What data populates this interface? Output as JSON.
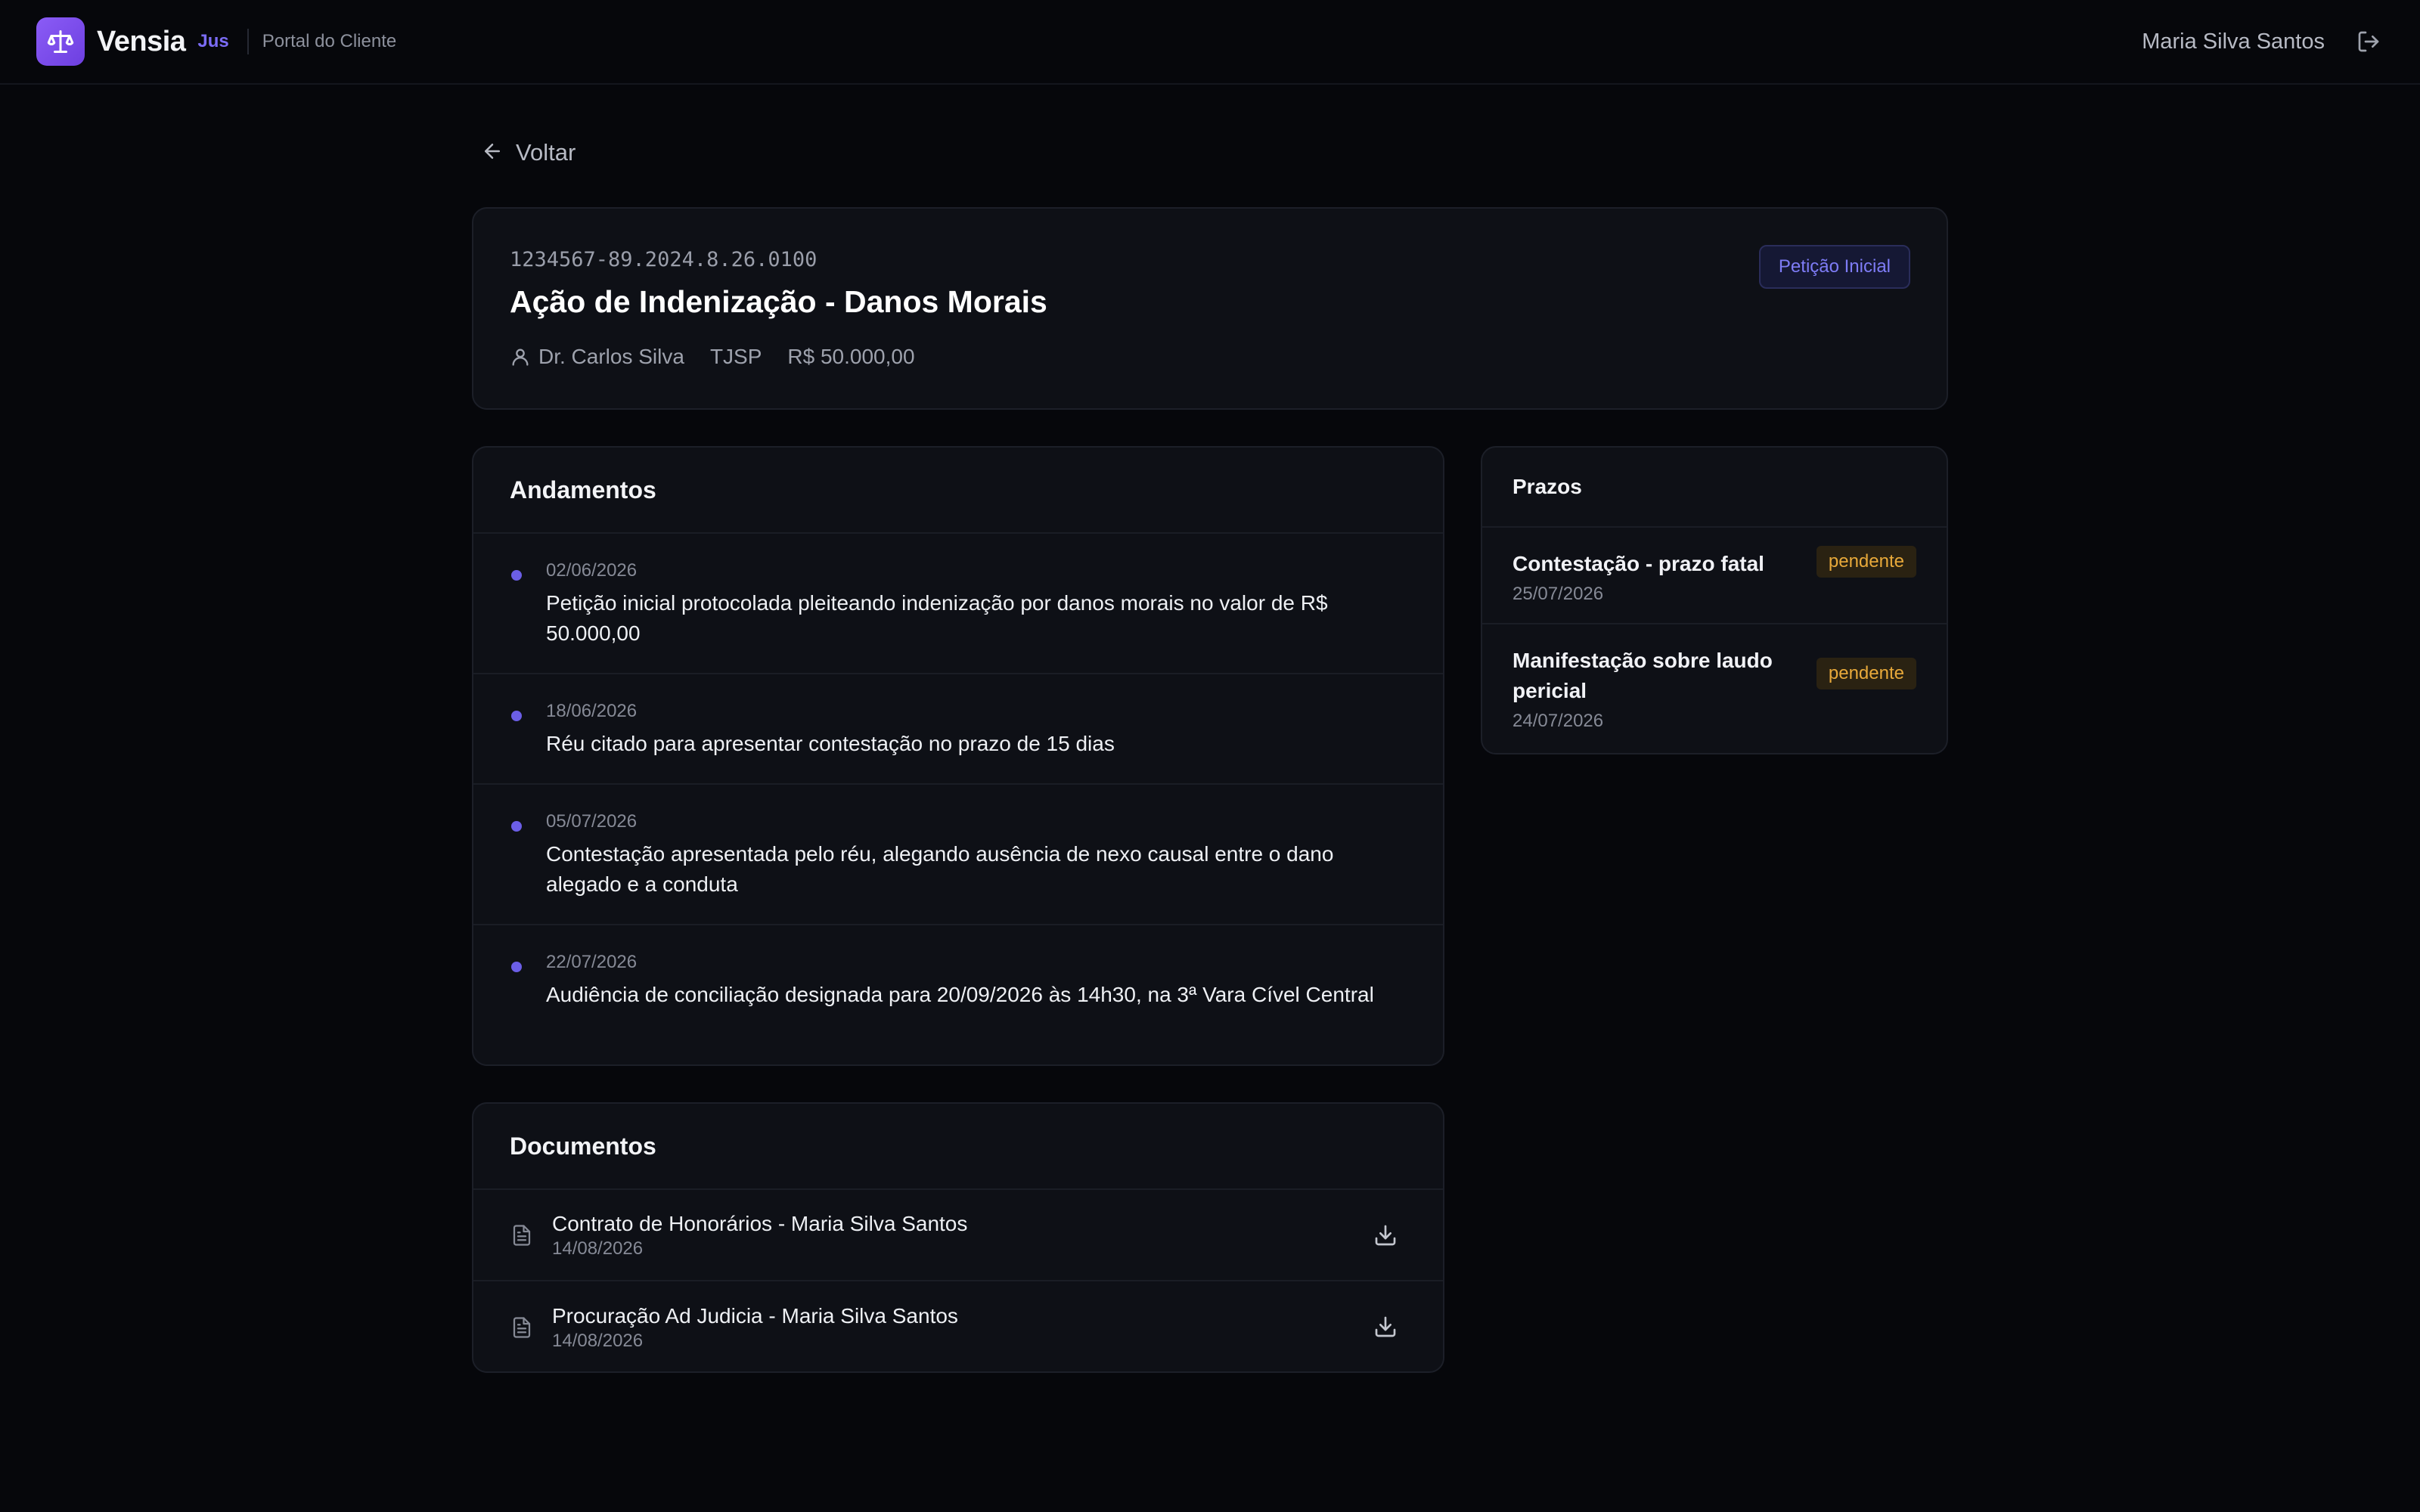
{
  "header": {
    "brand_name": "Vensia",
    "brand_tag": "Jus",
    "portal_label": "Portal do Cliente",
    "user_name": "Maria Silva Santos",
    "logo_icon": "scale-icon",
    "logout_icon": "logout-icon"
  },
  "back": {
    "label": "Voltar",
    "icon": "arrow-left-icon"
  },
  "case": {
    "number": "1234567-89.2024.8.26.0100",
    "title": "Ação de Indenização - Danos Morais",
    "lawyer": "Dr. Carlos Silva",
    "court": "TJSP",
    "value": "R$ 50.000,00",
    "phase": "Petição Inicial"
  },
  "moves": {
    "title": "Andamentos",
    "items": [
      {
        "date": "02/06/2026",
        "text": "Petição inicial protocolada pleiteando indenização por danos morais no valor de R$ 50.000,00"
      },
      {
        "date": "18/06/2026",
        "text": "Réu citado para apresentar contestação no prazo de 15 dias"
      },
      {
        "date": "05/07/2026",
        "text": "Contestação apresentada pelo réu, alegando ausência de nexo causal entre o dano alegado e a conduta"
      },
      {
        "date": "22/07/2026",
        "text": "Audiência de conciliação designada para 20/09/2026 às 14h30, na 3ª Vara Cível Central"
      }
    ]
  },
  "documents": {
    "title": "Documentos",
    "items": [
      {
        "name": "Contrato de Honorários - Maria Silva Santos",
        "date": "14/08/2026"
      },
      {
        "name": "Procuração Ad Judicia - Maria Silva Santos",
        "date": "14/08/2026"
      }
    ]
  },
  "deadlines": {
    "title": "Prazos",
    "items": [
      {
        "title": "Contestação - prazo fatal",
        "date": "25/07/2026",
        "status": "pendente"
      },
      {
        "title": "Manifestação sobre laudo pericial",
        "date": "24/07/2026",
        "status": "pendente"
      }
    ]
  },
  "colors": {
    "accent": "#7b6cf6",
    "logo_gradient_start": "#8b5cf6",
    "pending_text": "#e8a93a",
    "background": "#06070b",
    "card": "#0e1016"
  }
}
